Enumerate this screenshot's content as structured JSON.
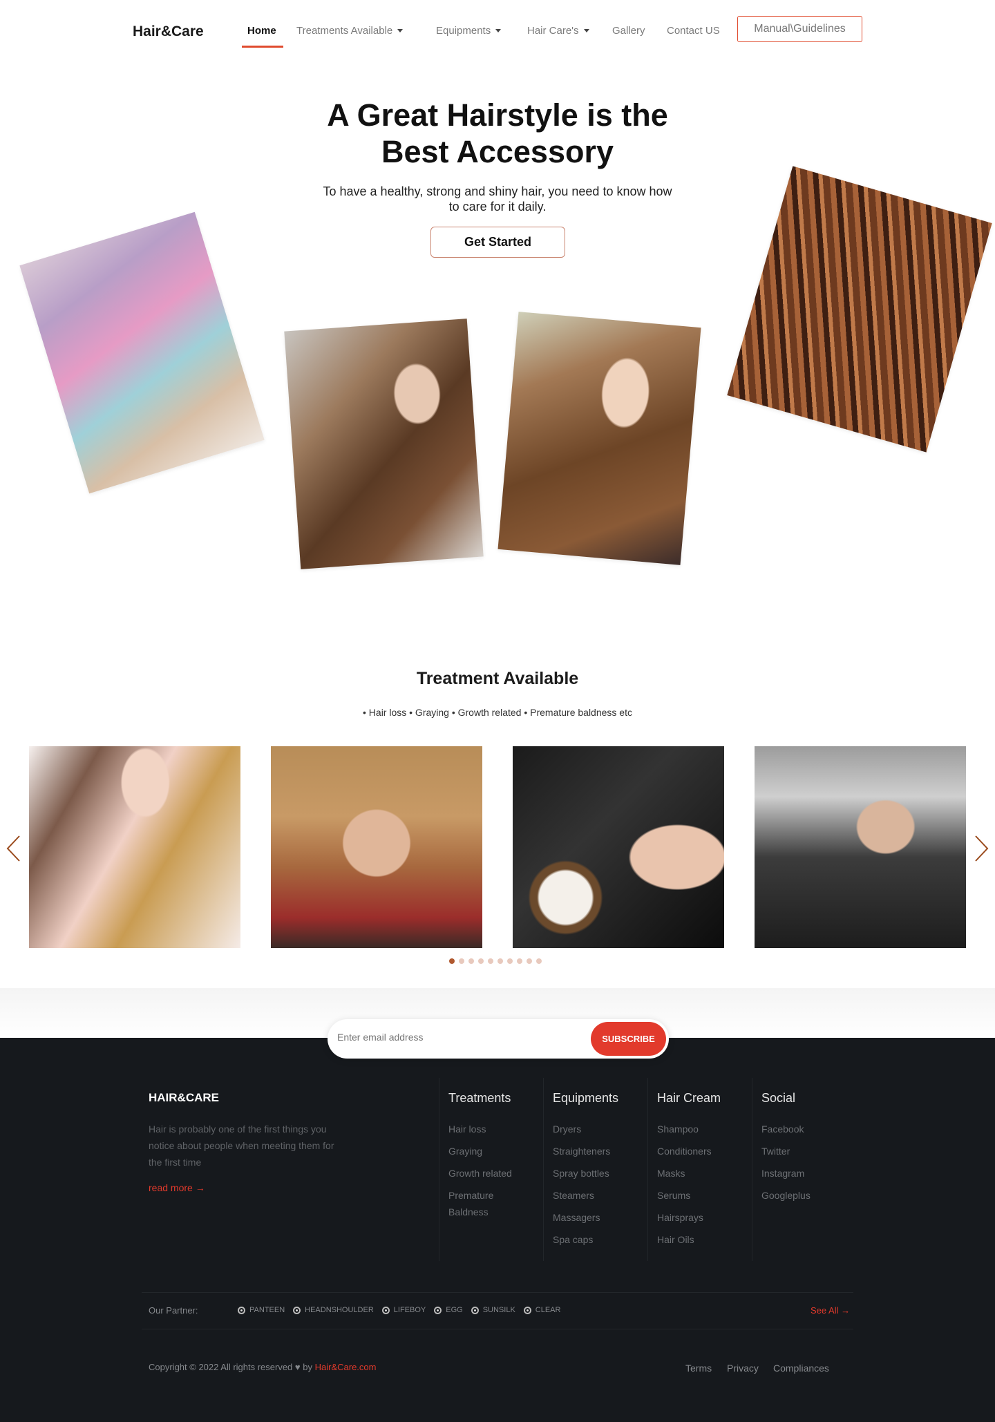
{
  "nav": {
    "brand": "Hair&Care",
    "items": [
      {
        "label": "Home",
        "active": true
      },
      {
        "label": "Treatments Available",
        "dropdown": true
      },
      {
        "label": "Equipments",
        "dropdown": true
      },
      {
        "label": "Hair Care's",
        "dropdown": true
      },
      {
        "label": "Gallery"
      },
      {
        "label": "Contact US"
      }
    ],
    "cta": "Manual\\Guidelines",
    "accent": "#e04b2e"
  },
  "hero": {
    "title": "A Great Hairstyle is the Best Accessory",
    "subtitle": "To have a healthy, strong and shiny hair, you need to know how to care for it daily.",
    "button": "Get Started"
  },
  "treatment": {
    "title": "Treatment Available",
    "subtitle": "• Hair loss • Graying • Growth related • Premature baldness etc",
    "slides": 10,
    "active_slide": 1
  },
  "footer": {
    "subscribe": {
      "placeholder": "Enter email address",
      "button": "SUBSCRIBE"
    },
    "brand": "HAIR&CARE",
    "description": "Hair is probably one of the first things you notice about people when meeting them for the first time",
    "read_more": "read more →",
    "columns": [
      {
        "title": "Treatments",
        "items": [
          "Hair loss",
          "Graying",
          "Growth related",
          "Premature Baldness"
        ]
      },
      {
        "title": "Equipments",
        "items": [
          "Dryers",
          "Straighteners",
          "Spray bottles",
          "Steamers",
          "Massagers",
          "Spa caps"
        ]
      },
      {
        "title": "Hair Cream",
        "items": [
          "Shampoo",
          "Conditioners",
          "Masks",
          "Serums",
          "Hairsprays",
          "Hair Oils"
        ]
      },
      {
        "title": "Social",
        "items": [
          "Facebook",
          "Twitter",
          "Instagram",
          "Googleplus"
        ]
      }
    ],
    "partner_label": "Our Partner:",
    "partners": [
      "PANTEEN",
      "HEADNSHOULDER",
      "LIFEBOY",
      "EGG",
      "SUNSILK",
      "CLEAR"
    ],
    "see_all": "See All →",
    "copyright": "Copyright © 2022 All rights reserved",
    "copyright_by": "by",
    "copyright_link": "Hair&Care.com",
    "legal": [
      "Terms",
      "Privacy",
      "Compliances"
    ],
    "accent": "#e23a2c"
  }
}
